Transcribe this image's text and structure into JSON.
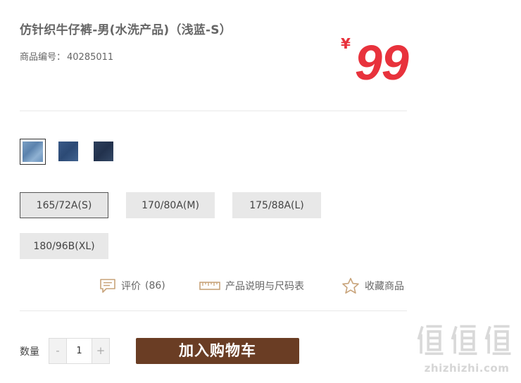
{
  "product": {
    "title": "仿针织牛仔裤-男(水洗产品)（浅蓝-S）",
    "sku_label": "商品编号：",
    "sku_value": "40285011",
    "currency": "¥",
    "price": "99"
  },
  "colors": {
    "swatches": [
      {
        "name": "light-blue",
        "selected": true
      },
      {
        "name": "mid-blue",
        "selected": false
      },
      {
        "name": "dark-blue",
        "selected": false
      }
    ]
  },
  "sizes": {
    "options": [
      {
        "label": "165/72A(S)",
        "selected": true
      },
      {
        "label": "170/80A(M)",
        "selected": false
      },
      {
        "label": "175/88A(L)",
        "selected": false
      },
      {
        "label": "180/96B(XL)",
        "selected": false
      }
    ]
  },
  "links": {
    "reviews_label": "评价",
    "reviews_count": "(86)",
    "size_chart_label": "产品说明与尺码表",
    "favorite_label": "收藏商品"
  },
  "purchase": {
    "quantity_label": "数量",
    "minus": "-",
    "quantity": "1",
    "plus": "+",
    "add_to_cart": "加入购物车"
  },
  "watermark": {
    "site": "zhizhizhi.com"
  },
  "theme": {
    "price_color": "#e8323c",
    "cart_button_color": "#6a3d24",
    "icon_color": "#c8a37a"
  },
  "icons": [
    "comment-icon",
    "ruler-icon",
    "star-icon",
    "watermark-logo"
  ]
}
